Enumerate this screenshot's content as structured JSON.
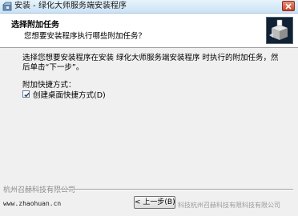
{
  "window": {
    "title": "安装 - 绿化大师服务端安装程序",
    "close_icon": "close-icon"
  },
  "header": {
    "title": "选择附加任务",
    "subtitle": "您想要安装程序执行哪些附加任务？",
    "image_icon": "installer-box-icon"
  },
  "body": {
    "description": "选择您想要安装程序在安装  绿化大师服务端安装程序  时执行的附加任务，然后单击“下一步”。",
    "group_label": "附加快捷方式：",
    "tasks": [
      {
        "label": "创建桌面快捷方式(D)",
        "checked": true
      }
    ]
  },
  "footer": {
    "company": "杭州召赫科技有限公司",
    "link": "www.zhaohuan.cn",
    "back_label": "< 上一步(B)",
    "watermark": "科技杭州召赫科技有限科技有限公司"
  },
  "colors": {
    "titlebar": "#c9e2f5",
    "header_bg": "#ffffff",
    "dialog_bg": "#f0f0f0",
    "close_button": "#c9452c"
  }
}
